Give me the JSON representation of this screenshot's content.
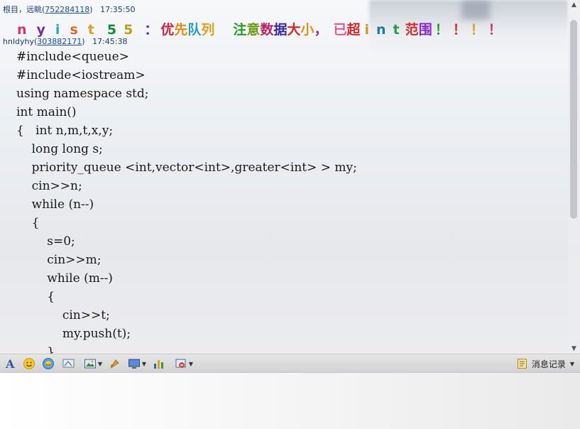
{
  "messages": {
    "msg1_header": {
      "sender": "根目，远眺(",
      "qq": "752284118",
      "close": ")",
      "time": "17:35:50"
    },
    "msg1_chars": [
      {
        "ch": "n",
        "color": "#e0306b"
      },
      {
        "ch": "y",
        "color": "#7b2ea8"
      },
      {
        "ch": "i",
        "color": "#2aa6c9"
      },
      {
        "ch": "s",
        "color": "#d46b2a"
      },
      {
        "ch": "t",
        "color": "#d4a02a"
      },
      {
        "ch": "5",
        "color": "#1a8a3a"
      },
      {
        "ch": "5",
        "color": "#b3a21a"
      },
      {
        "ch": "：",
        "color": "#6a2ac4"
      },
      {
        "ch": "优",
        "color": "#d4204a"
      },
      {
        "ch": "先",
        "color": "#e09018"
      },
      {
        "ch": "队",
        "color": "#2a9cc4"
      },
      {
        "ch": "列",
        "color": "#e0a020"
      },
      {
        "ch": "注",
        "color": "#2a9a2a"
      },
      {
        "ch": "意",
        "color": "#6a9a18"
      },
      {
        "ch": "数",
        "color": "#c0206a"
      },
      {
        "ch": "据",
        "color": "#3a2a9a"
      },
      {
        "ch": "大",
        "color": "#d42a2a"
      },
      {
        "ch": "小",
        "color": "#e09018"
      },
      {
        "ch": "，",
        "color": "#9a2aa8"
      },
      {
        "ch": "已",
        "color": "#e05a8a"
      },
      {
        "ch": "超",
        "color": "#d42a2a"
      },
      {
        "ch": "i",
        "color": "#c0a020"
      },
      {
        "ch": "n",
        "color": "#1a7aa8"
      },
      {
        "ch": "t",
        "color": "#2a9a4a"
      },
      {
        "ch": "范",
        "color": "#d42a2a"
      },
      {
        "ch": "围",
        "color": "#8a2ac4"
      },
      {
        "ch": "！",
        "color": "#2a9a2a"
      },
      {
        "ch": "！",
        "color": "#d42a2a"
      },
      {
        "ch": "！",
        "color": "#d4a02a"
      },
      {
        "ch": "！",
        "color": "#e0306b"
      }
    ],
    "msg2_header": {
      "sender": "hnldyhy(",
      "qq": "303882171",
      "close": ")",
      "time": "17:45:38"
    },
    "msg2_code": [
      "#include<queue>",
      "#include<iostream>",
      "using namespace std;",
      "int main()",
      "{   int n,m,t,x,y;",
      "    long long s;",
      "    priority_queue <int,vector<int>,greater<int> > my;",
      "    cin>>n;",
      "    while (n--)",
      "    {",
      "        s=0;",
      "        cin>>m;",
      "        while (m--)",
      "        {",
      "            cin>>t;",
      "            my.push(t);",
      "        }"
    ]
  },
  "toolbar": {
    "icons": [
      "font-icon",
      "emoji-icon",
      "magic-emoji-icon",
      "shake-icon",
      "image-icon",
      "screenshot-icon",
      "screen-share-icon",
      "vote-icon",
      "more-icon"
    ],
    "history_label": "消息记录"
  },
  "colors": {
    "header_text": "#1c3d7a",
    "qq_link": "#1a4fa8",
    "code_text": "#1a1a1a",
    "toolbar_bg": "#dcdcde"
  }
}
